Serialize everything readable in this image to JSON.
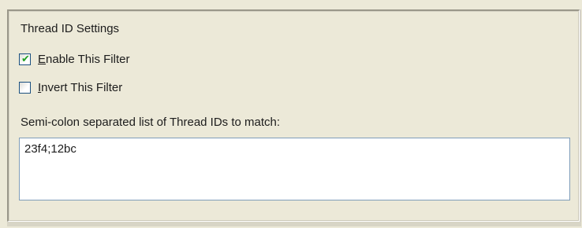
{
  "group": {
    "title": "Thread ID Settings"
  },
  "enable_filter": {
    "label_accel": "E",
    "label_rest": "nable This Filter",
    "checked": true
  },
  "invert_filter": {
    "label_accel": "I",
    "label_rest": "nvert This Filter",
    "checked": false
  },
  "thread_ids": {
    "label": "Semi-colon separated list of Thread IDs to match:",
    "value": "23f4;12bc"
  },
  "colors": {
    "background": "#ece9d8",
    "checkbox_border": "#1c5180",
    "check_mark": "#21a121",
    "textbox_border": "#7f9db9"
  }
}
